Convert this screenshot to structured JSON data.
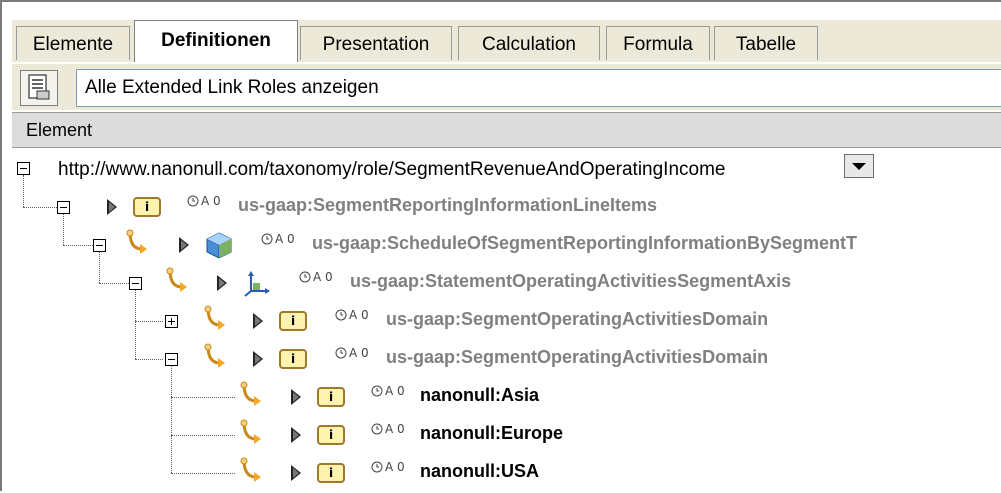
{
  "tabs": [
    "Elemente",
    "Definitionen",
    "Presentation",
    "Calculation",
    "Formula",
    "Tabelle"
  ],
  "active_tab": "Definitionen",
  "link_role": {
    "label": "Alle Extended Link Roles anzeigen"
  },
  "column_header": "Element",
  "tree": {
    "role_url": "http://www.nanonull.com/taxonomy/role/SegmentRevenueAndOperatingIncome",
    "meta_marker": "A 0",
    "items": [
      {
        "label": "us-gaap:SegmentReportingInformationLineItems"
      },
      {
        "label": "us-gaap:ScheduleOfSegmentReportingInformationBySegmentT"
      },
      {
        "label": "us-gaap:StatementOperatingActivitiesSegmentAxis"
      },
      {
        "label": "us-gaap:SegmentOperatingActivitiesDomain"
      },
      {
        "label": "us-gaap:SegmentOperatingActivitiesDomain"
      },
      {
        "label": "nanonull:Asia"
      },
      {
        "label": "nanonull:Europe"
      },
      {
        "label": "nanonull:USA"
      }
    ],
    "item_icon_letter": "i"
  }
}
